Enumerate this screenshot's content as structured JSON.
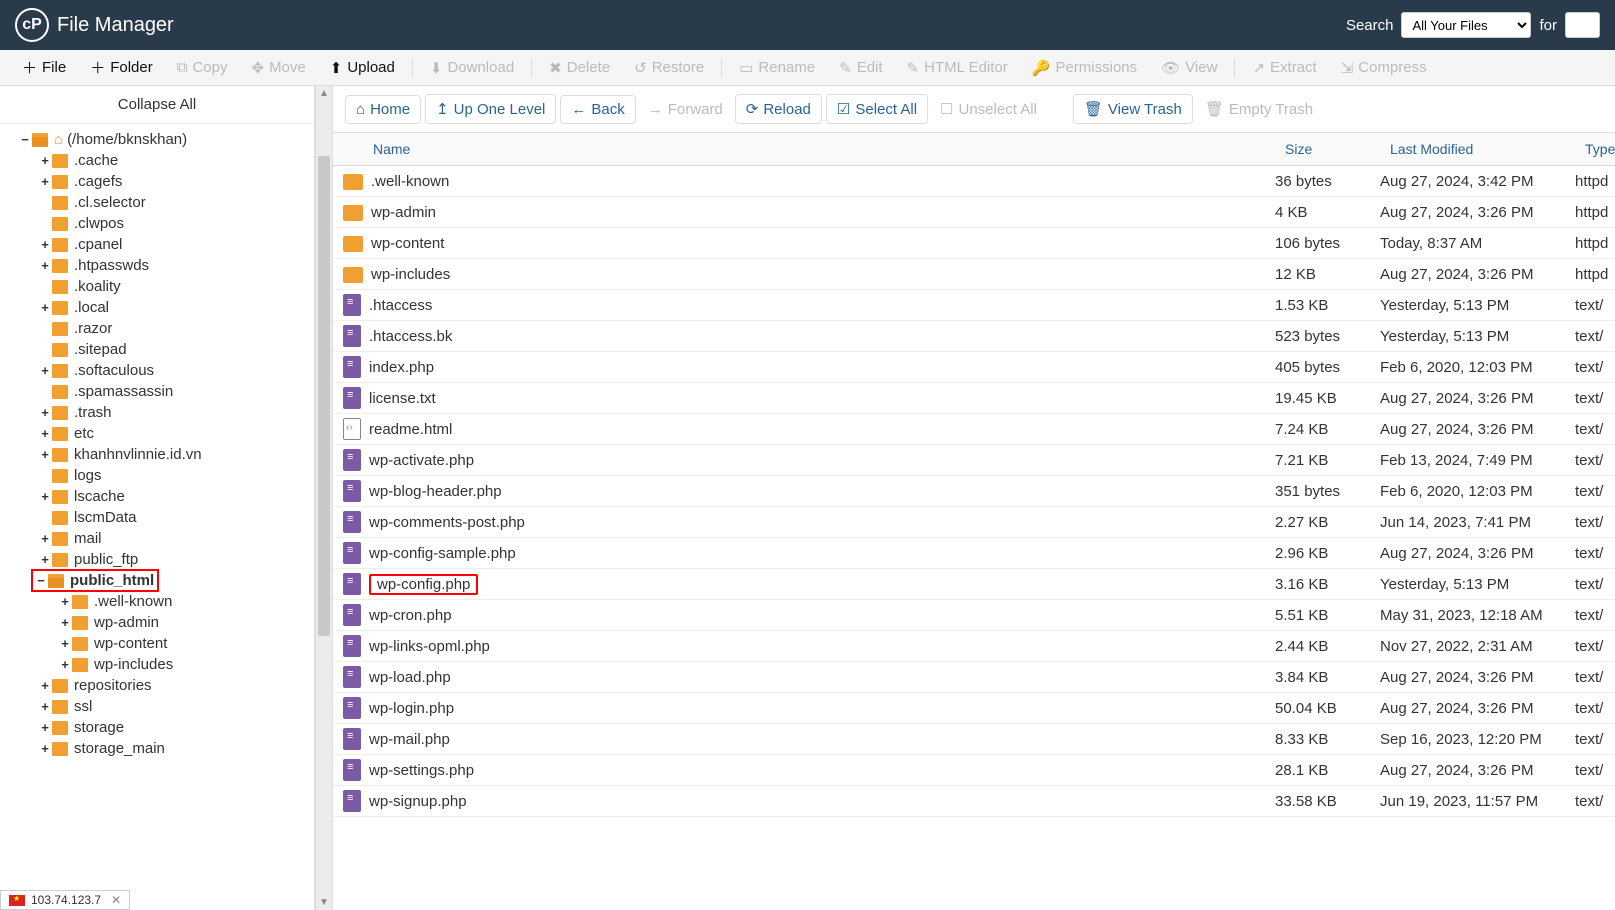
{
  "header": {
    "title": "File Manager",
    "searchLabel": "Search",
    "searchScope": "All Your Files",
    "forLabel": "for"
  },
  "toolbar": [
    {
      "id": "file",
      "label": "File",
      "bold": true,
      "icon": "plus"
    },
    {
      "id": "folder",
      "label": "Folder",
      "bold": true,
      "icon": "plus"
    },
    {
      "id": "copy",
      "label": "Copy",
      "disabled": true,
      "icon": "copy"
    },
    {
      "id": "move",
      "label": "Move",
      "disabled": true,
      "icon": "move"
    },
    {
      "id": "upload",
      "label": "Upload",
      "bold": true,
      "icon": "upload"
    },
    {
      "id": "download",
      "label": "Download",
      "disabled": true,
      "icon": "download",
      "sepBefore": true
    },
    {
      "id": "delete",
      "label": "Delete",
      "disabled": true,
      "icon": "delete",
      "sepBefore": true
    },
    {
      "id": "restore",
      "label": "Restore",
      "disabled": true,
      "icon": "restore"
    },
    {
      "id": "rename",
      "label": "Rename",
      "disabled": true,
      "icon": "rename",
      "sepBefore": true
    },
    {
      "id": "edit",
      "label": "Edit",
      "disabled": true,
      "icon": "edit"
    },
    {
      "id": "htmleditor",
      "label": "HTML Editor",
      "disabled": true,
      "icon": "htmleditor"
    },
    {
      "id": "permissions",
      "label": "Permissions",
      "disabled": true,
      "icon": "permissions"
    },
    {
      "id": "view",
      "label": "View",
      "disabled": true,
      "icon": "view"
    },
    {
      "id": "extract",
      "label": "Extract",
      "disabled": true,
      "icon": "extract",
      "sepBefore": true
    },
    {
      "id": "compress",
      "label": "Compress",
      "disabled": true,
      "icon": "compress"
    }
  ],
  "tree": {
    "collapseLabel": "Collapse All",
    "rootLabel": "(/home/bknskhan)",
    "nodes": [
      {
        "label": ".cache",
        "depth": 1,
        "exp": "+"
      },
      {
        "label": ".cagefs",
        "depth": 1,
        "exp": "+"
      },
      {
        "label": ".cl.selector",
        "depth": 1,
        "exp": ""
      },
      {
        "label": ".clwpos",
        "depth": 1,
        "exp": ""
      },
      {
        "label": ".cpanel",
        "depth": 1,
        "exp": "+"
      },
      {
        "label": ".htpasswds",
        "depth": 1,
        "exp": "+"
      },
      {
        "label": ".koality",
        "depth": 1,
        "exp": ""
      },
      {
        "label": ".local",
        "depth": 1,
        "exp": "+"
      },
      {
        "label": ".razor",
        "depth": 1,
        "exp": ""
      },
      {
        "label": ".sitepad",
        "depth": 1,
        "exp": ""
      },
      {
        "label": ".softaculous",
        "depth": 1,
        "exp": "+"
      },
      {
        "label": ".spamassassin",
        "depth": 1,
        "exp": ""
      },
      {
        "label": ".trash",
        "depth": 1,
        "exp": "+"
      },
      {
        "label": "etc",
        "depth": 1,
        "exp": "+"
      },
      {
        "label": "khanhnvlinnie.id.vn",
        "depth": 1,
        "exp": "+"
      },
      {
        "label": "logs",
        "depth": 1,
        "exp": ""
      },
      {
        "label": "lscache",
        "depth": 1,
        "exp": "+"
      },
      {
        "label": "lscmData",
        "depth": 1,
        "exp": ""
      },
      {
        "label": "mail",
        "depth": 1,
        "exp": "+"
      },
      {
        "label": "public_ftp",
        "depth": 1,
        "exp": "+"
      },
      {
        "label": "public_html",
        "depth": 1,
        "exp": "−",
        "selected": true,
        "open": true
      },
      {
        "label": ".well-known",
        "depth": 2,
        "exp": "+"
      },
      {
        "label": "wp-admin",
        "depth": 2,
        "exp": "+"
      },
      {
        "label": "wp-content",
        "depth": 2,
        "exp": "+"
      },
      {
        "label": "wp-includes",
        "depth": 2,
        "exp": "+"
      },
      {
        "label": "repositories",
        "depth": 1,
        "exp": "+"
      },
      {
        "label": "ssl",
        "depth": 1,
        "exp": "+"
      },
      {
        "label": "storage",
        "depth": 1,
        "exp": "+"
      },
      {
        "label": "storage_main",
        "depth": 1,
        "exp": "+"
      }
    ]
  },
  "contentToolbar": {
    "home": "Home",
    "up": "Up One Level",
    "back": "Back",
    "forward": "Forward",
    "reload": "Reload",
    "selectAll": "Select All",
    "unselectAll": "Unselect All",
    "viewTrash": "View Trash",
    "emptyTrash": "Empty Trash"
  },
  "columns": {
    "name": "Name",
    "size": "Size",
    "mod": "Last Modified",
    "type": "Type"
  },
  "files": [
    {
      "name": ".well-known",
      "size": "36 bytes",
      "mod": "Aug 27, 2024, 3:42 PM",
      "type": "httpd",
      "icon": "folder"
    },
    {
      "name": "wp-admin",
      "size": "4 KB",
      "mod": "Aug 27, 2024, 3:26 PM",
      "type": "httpd",
      "icon": "folder"
    },
    {
      "name": "wp-content",
      "size": "106 bytes",
      "mod": "Today, 8:37 AM",
      "type": "httpd",
      "icon": "folder"
    },
    {
      "name": "wp-includes",
      "size": "12 KB",
      "mod": "Aug 27, 2024, 3:26 PM",
      "type": "httpd",
      "icon": "folder"
    },
    {
      "name": ".htaccess",
      "size": "1.53 KB",
      "mod": "Yesterday, 5:13 PM",
      "type": "text/",
      "icon": "doc"
    },
    {
      "name": ".htaccess.bk",
      "size": "523 bytes",
      "mod": "Yesterday, 5:13 PM",
      "type": "text/",
      "icon": "doc"
    },
    {
      "name": "index.php",
      "size": "405 bytes",
      "mod": "Feb 6, 2020, 12:03 PM",
      "type": "text/",
      "icon": "doc"
    },
    {
      "name": "license.txt",
      "size": "19.45 KB",
      "mod": "Aug 27, 2024, 3:26 PM",
      "type": "text/",
      "icon": "doc"
    },
    {
      "name": "readme.html",
      "size": "7.24 KB",
      "mod": "Aug 27, 2024, 3:26 PM",
      "type": "text/",
      "icon": "html"
    },
    {
      "name": "wp-activate.php",
      "size": "7.21 KB",
      "mod": "Feb 13, 2024, 7:49 PM",
      "type": "text/",
      "icon": "doc"
    },
    {
      "name": "wp-blog-header.php",
      "size": "351 bytes",
      "mod": "Feb 6, 2020, 12:03 PM",
      "type": "text/",
      "icon": "doc"
    },
    {
      "name": "wp-comments-post.php",
      "size": "2.27 KB",
      "mod": "Jun 14, 2023, 7:41 PM",
      "type": "text/",
      "icon": "doc"
    },
    {
      "name": "wp-config-sample.php",
      "size": "2.96 KB",
      "mod": "Aug 27, 2024, 3:26 PM",
      "type": "text/",
      "icon": "doc"
    },
    {
      "name": "wp-config.php",
      "size": "3.16 KB",
      "mod": "Yesterday, 5:13 PM",
      "type": "text/",
      "icon": "doc",
      "highlight": true
    },
    {
      "name": "wp-cron.php",
      "size": "5.51 KB",
      "mod": "May 31, 2023, 12:18 AM",
      "type": "text/",
      "icon": "doc"
    },
    {
      "name": "wp-links-opml.php",
      "size": "2.44 KB",
      "mod": "Nov 27, 2022, 2:31 AM",
      "type": "text/",
      "icon": "doc"
    },
    {
      "name": "wp-load.php",
      "size": "3.84 KB",
      "mod": "Aug 27, 2024, 3:26 PM",
      "type": "text/",
      "icon": "doc"
    },
    {
      "name": "wp-login.php",
      "size": "50.04 KB",
      "mod": "Aug 27, 2024, 3:26 PM",
      "type": "text/",
      "icon": "doc"
    },
    {
      "name": "wp-mail.php",
      "size": "8.33 KB",
      "mod": "Sep 16, 2023, 12:20 PM",
      "type": "text/",
      "icon": "doc"
    },
    {
      "name": "wp-settings.php",
      "size": "28.1 KB",
      "mod": "Aug 27, 2024, 3:26 PM",
      "type": "text/",
      "icon": "doc"
    },
    {
      "name": "wp-signup.php",
      "size": "33.58 KB",
      "mod": "Jun 19, 2023, 11:57 PM",
      "type": "text/",
      "icon": "doc"
    }
  ],
  "status": {
    "ip": "103.74.123.7"
  }
}
